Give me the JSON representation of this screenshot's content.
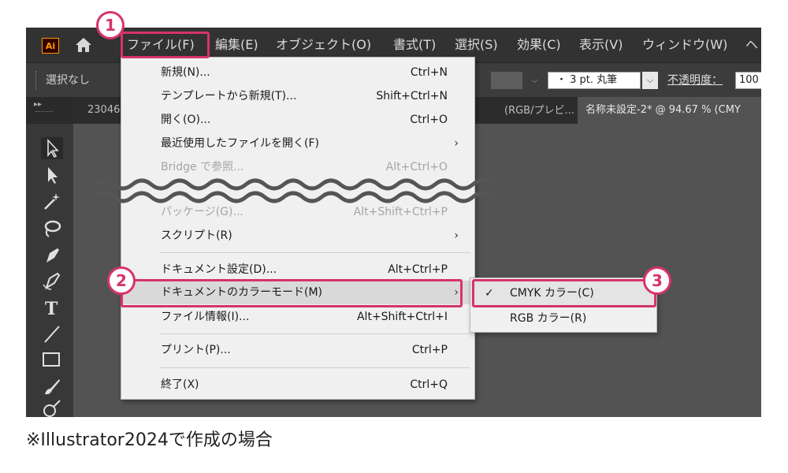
{
  "app": {
    "logo": "Ai",
    "home_icon": "home-icon",
    "menus": [
      "ファイル(F)",
      "編集(E)",
      "オブジェクト(O)",
      "書式(T)",
      "選択(S)",
      "効果(C)",
      "表示(V)",
      "ウィンドウ(W)",
      "ヘ"
    ]
  },
  "control_bar": {
    "selection": "選択なし",
    "stroke_value": "・  3 pt. 丸筆",
    "opacity_label": "不透明度：",
    "opacity_value": "100"
  },
  "tabs": [
    {
      "label": "23046",
      "active": false
    },
    {
      "label": "(RGB/プレビ...",
      "close": "×",
      "active": false
    },
    {
      "label": "名称未設定-2* @ 94.67 % (CMY",
      "active": true
    }
  ],
  "toolbar": {
    "collapse": "▸▸",
    "tools": [
      "selection-tool",
      "direct-selection-tool",
      "magic-wand-tool",
      "lasso-tool",
      "pen-tool",
      "curvature-tool",
      "type-tool",
      "line-tool",
      "rectangle-tool",
      "paintbrush-tool",
      "blob-tool"
    ]
  },
  "file_menu": {
    "items": [
      {
        "label": "新規(N)...",
        "shortcut": "Ctrl+N"
      },
      {
        "label": "テンプレートから新規(T)...",
        "shortcut": "Shift+Ctrl+N"
      },
      {
        "label": "開く(O)...",
        "shortcut": "Ctrl+O"
      },
      {
        "label": "最近使用したファイルを開く(F)",
        "shortcut": "",
        "submenu": true
      },
      {
        "label": "Bridge で参照...",
        "shortcut": "Alt+Ctrl+O",
        "disabled": true
      },
      {
        "label": "パッケージ(G)...",
        "shortcut": "Alt+Shift+Ctrl+P",
        "disabled": true
      },
      {
        "label": "スクリプト(R)",
        "shortcut": "",
        "submenu": true
      },
      {
        "label": "ドキュメント設定(D)...",
        "shortcut": "Alt+Ctrl+P"
      },
      {
        "label": "ドキュメントのカラーモード(M)",
        "shortcut": "",
        "submenu": true
      },
      {
        "label": "ファイル情報(I)...",
        "shortcut": "Alt+Shift+Ctrl+I"
      },
      {
        "label": "プリント(P)...",
        "shortcut": "Ctrl+P"
      },
      {
        "label": "終了(X)",
        "shortcut": "Ctrl+Q"
      }
    ],
    "arrow": "›"
  },
  "color_mode_submenu": {
    "items": [
      {
        "label": "CMYK カラー(C)",
        "checked": true,
        "check": "✓"
      },
      {
        "label": "RGB カラー(R)",
        "checked": false,
        "check": ""
      }
    ]
  },
  "annotations": {
    "step1": "1",
    "step2": "2",
    "step3": "3",
    "color": "#d6336c"
  },
  "footnote": "※Illustrator2024で作成の場合"
}
